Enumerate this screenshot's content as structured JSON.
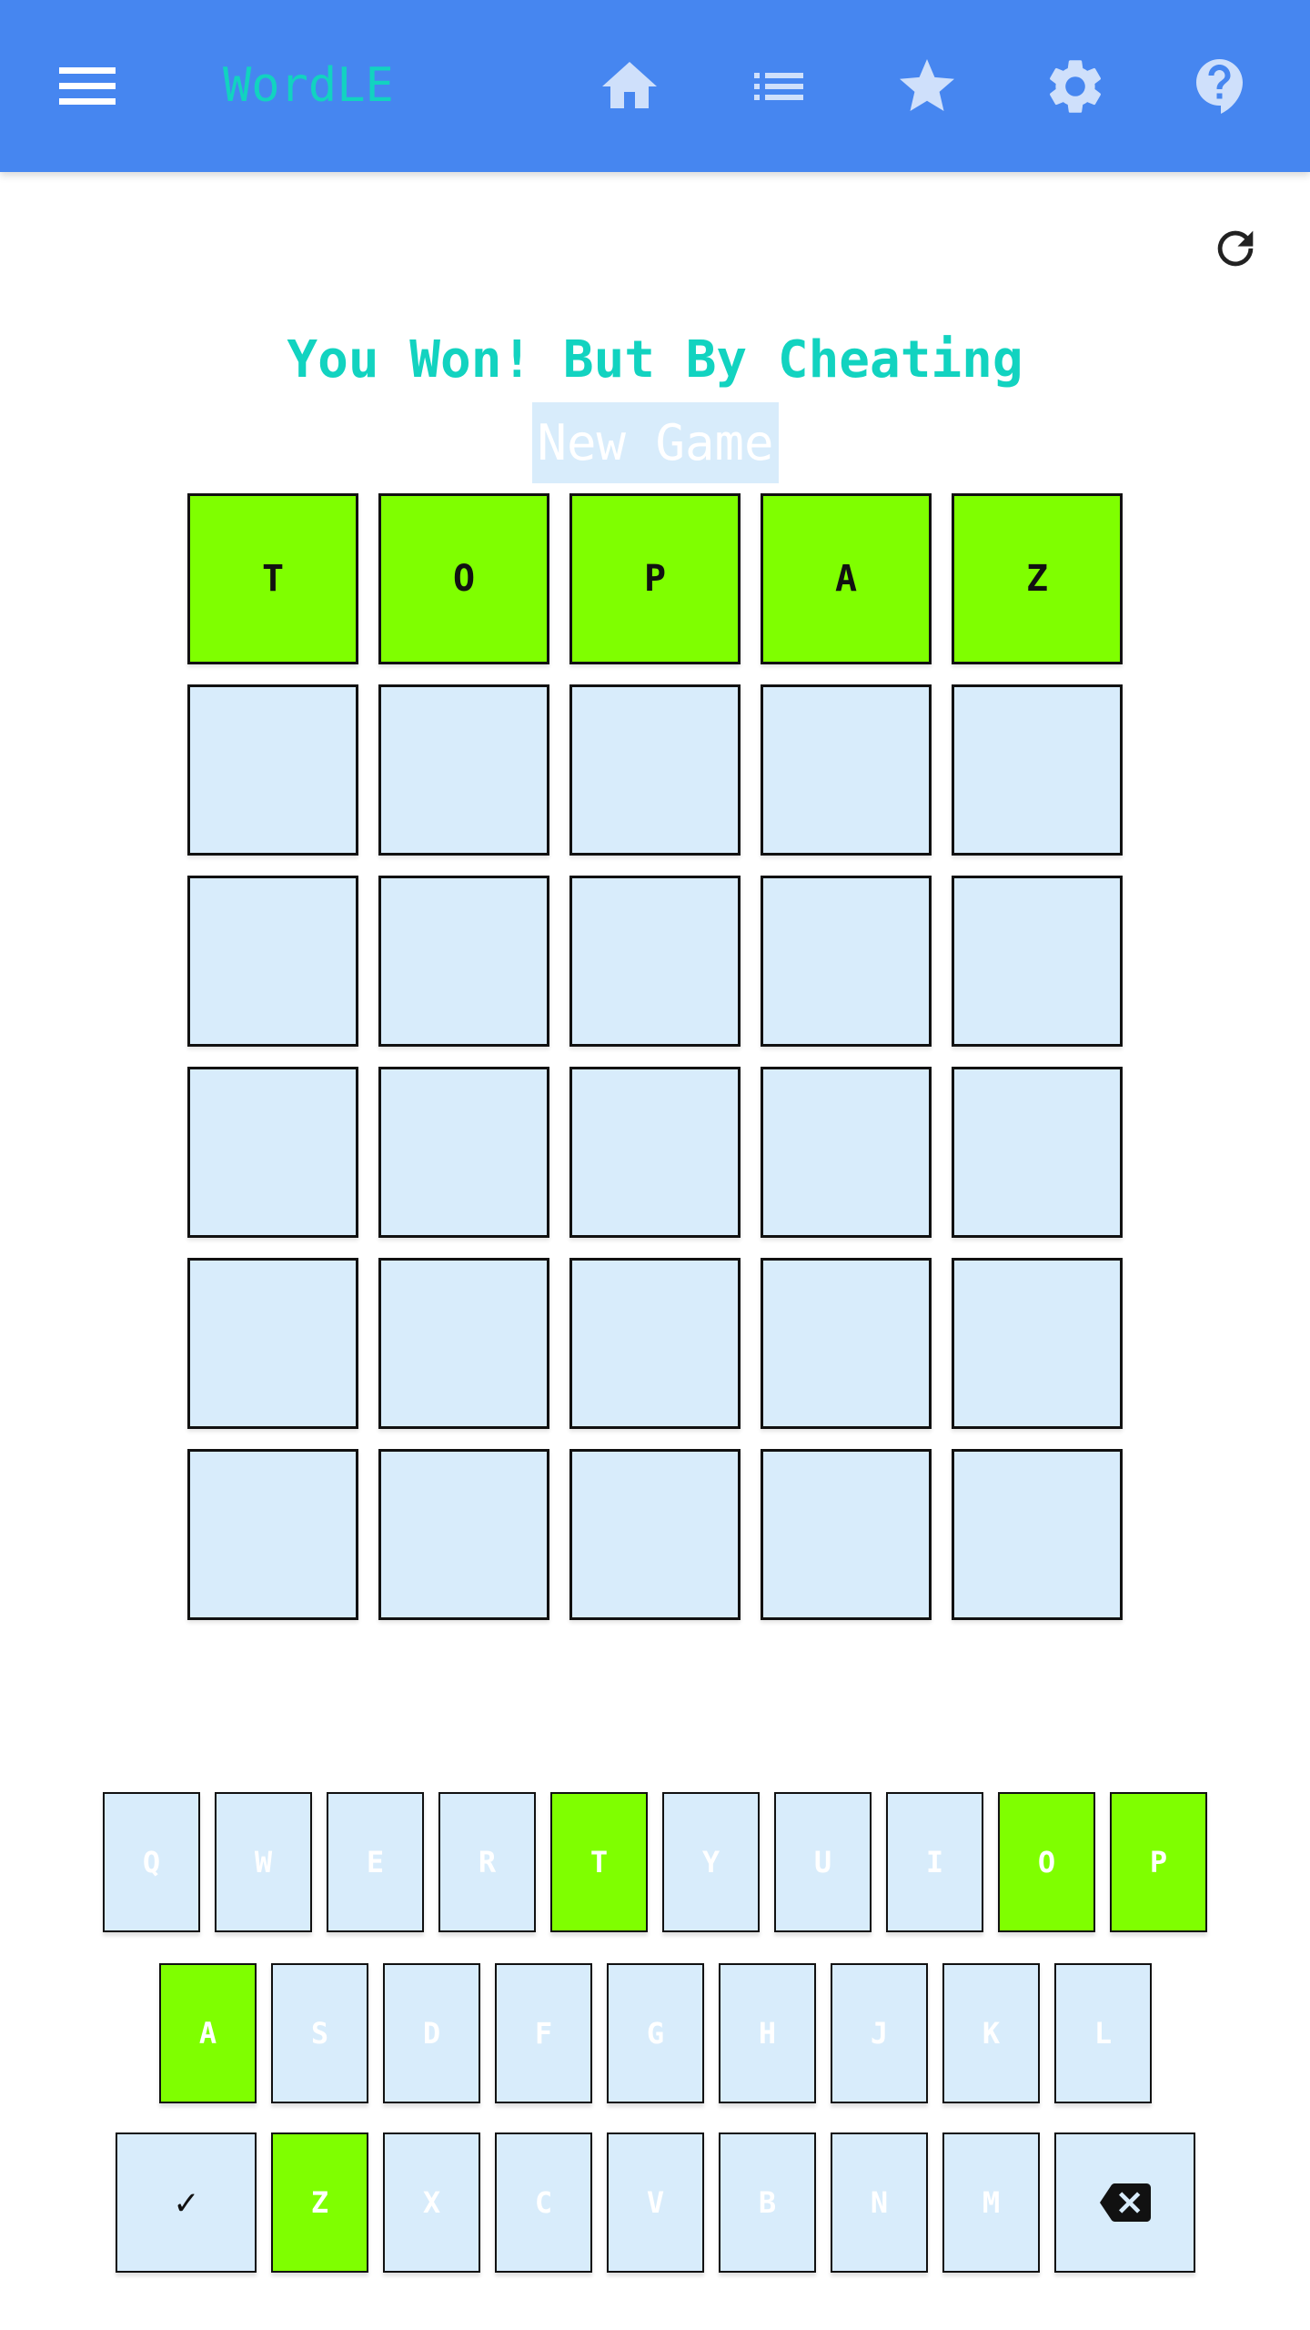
{
  "header": {
    "title": "WordLE",
    "icons": [
      "menu-icon",
      "home-icon",
      "list-icon",
      "star-icon",
      "gear-icon",
      "help-icon"
    ],
    "background": "#4686f0"
  },
  "game": {
    "status": "You Won! But By Cheating",
    "new_game_label": "New Game",
    "board": [
      [
        {
          "l": "T",
          "s": "correct"
        },
        {
          "l": "O",
          "s": "correct"
        },
        {
          "l": "P",
          "s": "correct"
        },
        {
          "l": "A",
          "s": "correct"
        },
        {
          "l": "Z",
          "s": "correct"
        }
      ],
      [
        {
          "l": "",
          "s": "empty"
        },
        {
          "l": "",
          "s": "empty"
        },
        {
          "l": "",
          "s": "empty"
        },
        {
          "l": "",
          "s": "empty"
        },
        {
          "l": "",
          "s": "empty"
        }
      ],
      [
        {
          "l": "",
          "s": "empty"
        },
        {
          "l": "",
          "s": "empty"
        },
        {
          "l": "",
          "s": "empty"
        },
        {
          "l": "",
          "s": "empty"
        },
        {
          "l": "",
          "s": "empty"
        }
      ],
      [
        {
          "l": "",
          "s": "empty"
        },
        {
          "l": "",
          "s": "empty"
        },
        {
          "l": "",
          "s": "empty"
        },
        {
          "l": "",
          "s": "empty"
        },
        {
          "l": "",
          "s": "empty"
        }
      ],
      [
        {
          "l": "",
          "s": "empty"
        },
        {
          "l": "",
          "s": "empty"
        },
        {
          "l": "",
          "s": "empty"
        },
        {
          "l": "",
          "s": "empty"
        },
        {
          "l": "",
          "s": "empty"
        }
      ],
      [
        {
          "l": "",
          "s": "empty"
        },
        {
          "l": "",
          "s": "empty"
        },
        {
          "l": "",
          "s": "empty"
        },
        {
          "l": "",
          "s": "empty"
        },
        {
          "l": "",
          "s": "empty"
        }
      ]
    ],
    "colors": {
      "correct": "#7fff00",
      "empty": "#d8ecfb"
    }
  },
  "keyboard": {
    "rows": [
      [
        "Q",
        "W",
        "E",
        "R",
        "T",
        "Y",
        "U",
        "I",
        "O",
        "P"
      ],
      [
        "A",
        "S",
        "D",
        "F",
        "G",
        "H",
        "J",
        "K",
        "L"
      ],
      [
        "ENTER",
        "Z",
        "X",
        "C",
        "V",
        "B",
        "N",
        "M",
        "BACKSPACE"
      ]
    ],
    "correct_keys": [
      "T",
      "O",
      "P",
      "A",
      "Z"
    ],
    "enter_symbol": "✓"
  }
}
